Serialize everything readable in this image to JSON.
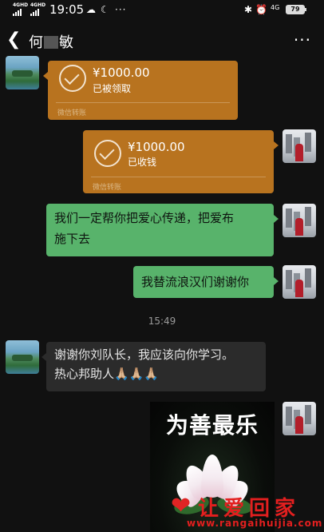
{
  "status_bar": {
    "signal_1": "4GHD",
    "signal_2": "4GHD",
    "time": "19:05",
    "network": "4G",
    "battery": "79"
  },
  "header": {
    "title_first": "何",
    "title_last": "敏"
  },
  "messages": {
    "transfer_received": {
      "amount": "¥1000.00",
      "status": "已被领取",
      "label": "微信转账"
    },
    "transfer_sent": {
      "amount": "¥1000.00",
      "status": "已收钱",
      "label": "微信转账"
    },
    "text_1_line1": "我们一定帮你把爱心传递，把爱布",
    "text_1_line2": "施下去",
    "text_2": "我替流浪汉们谢谢你",
    "timestamp": "15:49",
    "reply_line1": "谢谢你刘队长，我应该向你学习。",
    "reply_line2": "热心邦助人",
    "reply_emoji": "🙏🏼🙏🏼🙏🏼",
    "image_caption": "为善最乐"
  },
  "watermark": {
    "text": "让爱回家",
    "url": "www.rangaihuijia.com"
  },
  "colors": {
    "transfer_orange": "#b8731f",
    "bubble_green": "#58b36b",
    "bubble_dark": "#2b2b2b",
    "background": "#111111",
    "watermark_red": "#e31f1f"
  }
}
